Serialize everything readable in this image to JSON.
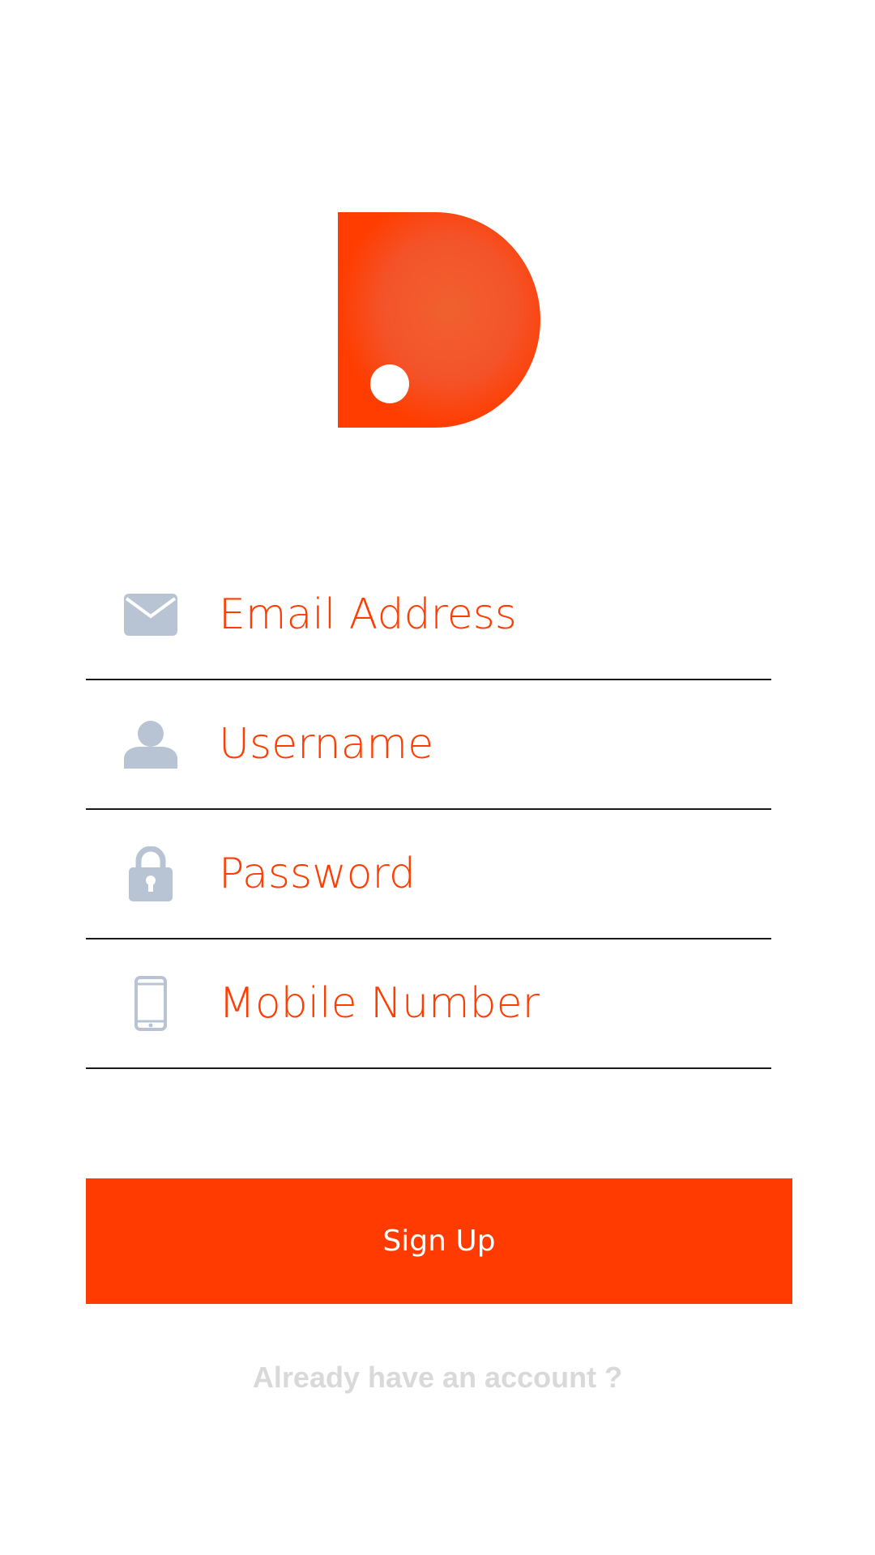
{
  "colors": {
    "accent": "#ff3d00",
    "icon": "#b8c4d4",
    "divider": "#1a1a1a",
    "link": "#d9d9d9",
    "background": "#ffffff"
  },
  "logo": {
    "icon": "brand-logo-d"
  },
  "form": {
    "email": {
      "placeholder": "Email Address",
      "icon": "envelope-icon"
    },
    "username": {
      "placeholder": "Username",
      "icon": "user-icon"
    },
    "password": {
      "placeholder": "Password",
      "icon": "lock-icon"
    },
    "mobile": {
      "placeholder": "Mobile Number",
      "icon": "phone-icon"
    }
  },
  "signup_button": {
    "label": "Sign Up"
  },
  "login_link": {
    "label": "Already have an account ?"
  }
}
